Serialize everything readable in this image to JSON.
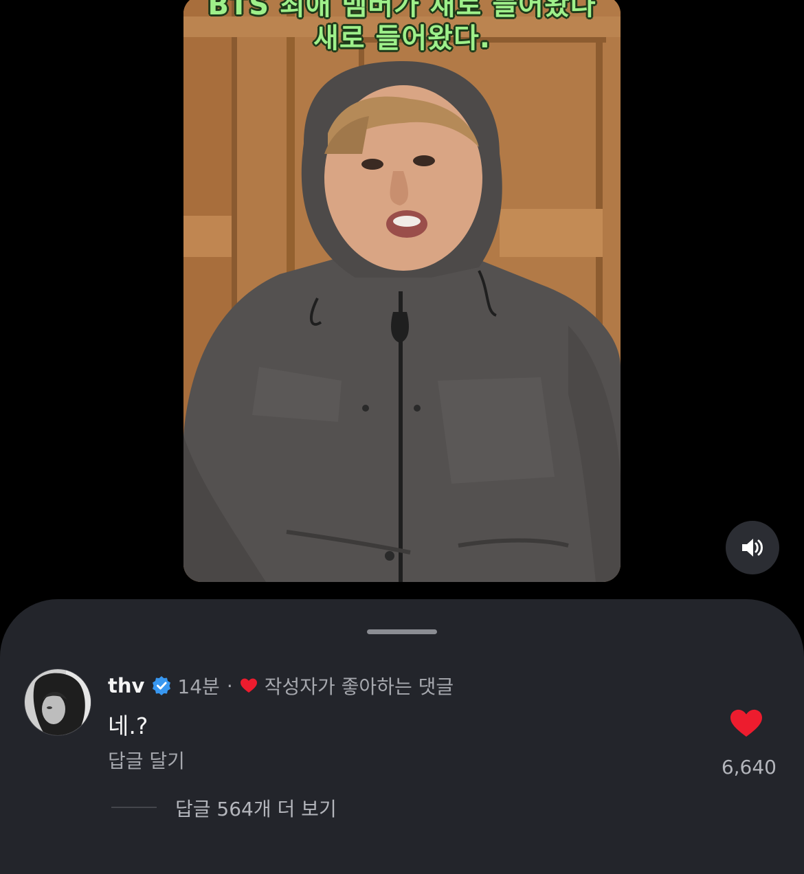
{
  "video": {
    "caption_lines": [
      "BTS 최애 멤버가 새로 들어왔다",
      "새로 들어왔다."
    ]
  },
  "controls": {
    "mute_icon": "speaker-volume-icon"
  },
  "comment": {
    "username": "thv",
    "verified_icon": "verified-badge-icon",
    "time": "14분",
    "separator": "·",
    "creator_liked_label": "작성자가 좋아하는 댓글",
    "text": "네.?",
    "reply_label": "답글 달기",
    "like_count": "6,640",
    "view_replies_label": "답글 564개 더 보기"
  },
  "colors": {
    "background": "#000000",
    "sheet": "#23252b",
    "heart": "#ed1c2e",
    "verified": "#3897f0",
    "caption": "#9ef08a"
  }
}
